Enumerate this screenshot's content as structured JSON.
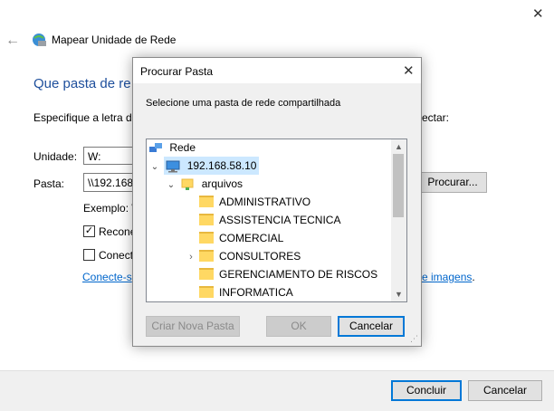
{
  "main": {
    "window_title": "Mapear Unidade de Rede",
    "heading": "Que pasta de re",
    "instruction_left": "Especifique a letra de",
    "instruction_right": "ectar:",
    "drive_label": "Unidade:",
    "drive_value": "W:",
    "folder_label": "Pasta:",
    "folder_value": "\\\\192.168",
    "browse_label": "Procurar...",
    "example_text": "Exemplo: \\",
    "reconnect_label": "Recone",
    "reconnect_checked": true,
    "other_creds_label": "Conect",
    "other_creds_checked": false,
    "link_left": "Conecte-s",
    "link_right": "e imagens",
    "link_right_suffix": ".",
    "finish_label": "Concluir",
    "cancel_label": "Cancelar"
  },
  "dialog": {
    "title": "Procurar Pasta",
    "description": "Selecione uma pasta de rede compartilhada",
    "tree": {
      "root": "Rede",
      "host": "192.168.58.10",
      "share": "arquivos",
      "folders": [
        {
          "name": "ADMINISTRATIVO",
          "expandable": false
        },
        {
          "name": "ASSISTENCIA TECNICA",
          "expandable": false
        },
        {
          "name": "COMERCIAL",
          "expandable": false
        },
        {
          "name": "CONSULTORES",
          "expandable": true
        },
        {
          "name": "GERENCIAMENTO DE RISCOS",
          "expandable": false
        },
        {
          "name": "INFORMATICA",
          "expandable": false
        }
      ]
    },
    "new_folder_label": "Criar Nova Pasta",
    "ok_label": "OK",
    "cancel_label": "Cancelar"
  },
  "colors": {
    "accent": "#0078d7",
    "heading_blue": "#1e4f9c",
    "link": "#0066cc",
    "folder_yellow": "#ffd863",
    "selection": "#cce8ff"
  }
}
